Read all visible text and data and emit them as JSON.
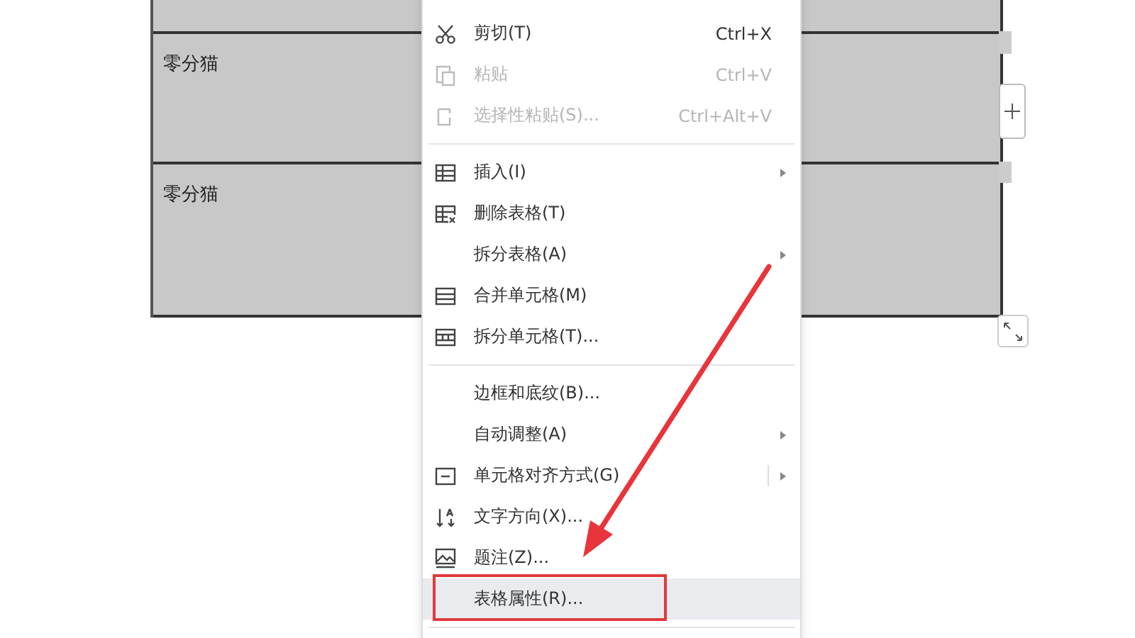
{
  "table": {
    "cells": [
      "零分猫",
      "零分猫"
    ]
  },
  "context_menu": {
    "items": [
      {
        "kind": "cut",
        "label": "剪切(T)",
        "shortcut": "Ctrl+X",
        "disabled": false,
        "selected": false,
        "submenu": false,
        "split_button": false
      },
      {
        "kind": "paste",
        "label": "粘贴",
        "shortcut": "Ctrl+V",
        "disabled": true,
        "selected": false,
        "submenu": false,
        "split_button": false
      },
      {
        "kind": "pastespecial",
        "label": "选择性粘贴(S)...",
        "shortcut": "Ctrl+Alt+V",
        "disabled": true,
        "selected": false,
        "submenu": false,
        "split_button": false
      },
      {
        "kind": "separator"
      },
      {
        "kind": "insert",
        "label": "插入(I)",
        "disabled": false,
        "selected": false,
        "submenu": true,
        "split_button": false
      },
      {
        "kind": "deletetable",
        "label": "删除表格(T)",
        "disabled": false,
        "selected": false,
        "submenu": false,
        "split_button": false
      },
      {
        "kind": "plain",
        "label": "拆分表格(A)",
        "disabled": false,
        "selected": false,
        "submenu": true,
        "split_button": false
      },
      {
        "kind": "merge",
        "label": "合并单元格(M)",
        "disabled": false,
        "selected": false,
        "submenu": false,
        "split_button": false
      },
      {
        "kind": "splitcells",
        "label": "拆分单元格(T)...",
        "disabled": false,
        "selected": false,
        "submenu": false,
        "split_button": false
      },
      {
        "kind": "separator"
      },
      {
        "kind": "plain",
        "label": "边框和底纹(B)...",
        "disabled": false,
        "selected": false,
        "submenu": false,
        "split_button": false
      },
      {
        "kind": "plain",
        "label": "自动调整(A)",
        "disabled": false,
        "selected": false,
        "submenu": true,
        "split_button": false
      },
      {
        "kind": "align",
        "label": "单元格对齐方式(G)",
        "disabled": false,
        "selected": false,
        "submenu": true,
        "split_button": true
      },
      {
        "kind": "direction",
        "label": "文字方向(X)...",
        "disabled": false,
        "selected": false,
        "submenu": false,
        "split_button": false
      },
      {
        "kind": "caption",
        "label": "题注(Z)...",
        "disabled": false,
        "selected": false,
        "submenu": false,
        "split_button": false
      },
      {
        "kind": "plain",
        "label": "表格属性(R)...",
        "disabled": false,
        "selected": true,
        "submenu": false,
        "split_button": false
      },
      {
        "kind": "separator"
      }
    ]
  }
}
